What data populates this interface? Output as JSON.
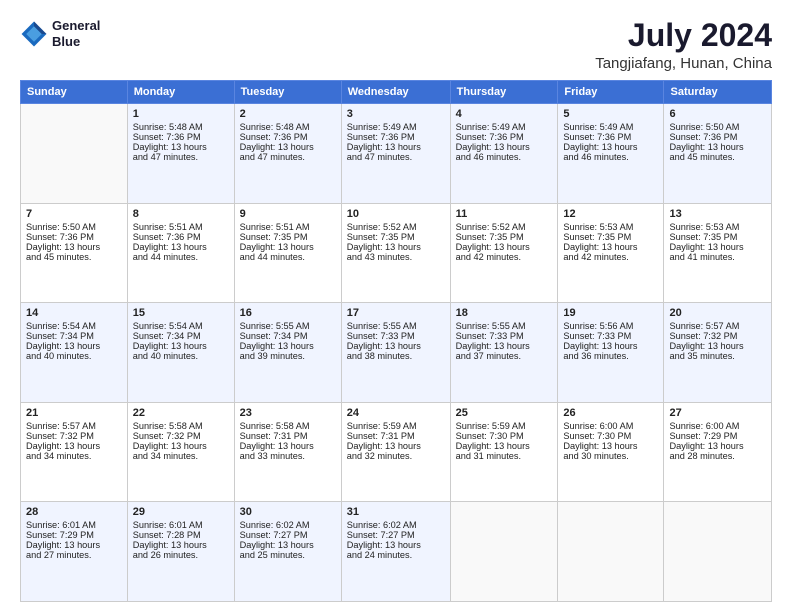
{
  "header": {
    "logo_line1": "General",
    "logo_line2": "Blue",
    "main_title": "July 2024",
    "subtitle": "Tangjiafang, Hunan, China"
  },
  "weekdays": [
    "Sunday",
    "Monday",
    "Tuesday",
    "Wednesday",
    "Thursday",
    "Friday",
    "Saturday"
  ],
  "weeks": [
    [
      {
        "day": "",
        "text": ""
      },
      {
        "day": "1",
        "text": "Sunrise: 5:48 AM\nSunset: 7:36 PM\nDaylight: 13 hours\nand 47 minutes."
      },
      {
        "day": "2",
        "text": "Sunrise: 5:48 AM\nSunset: 7:36 PM\nDaylight: 13 hours\nand 47 minutes."
      },
      {
        "day": "3",
        "text": "Sunrise: 5:49 AM\nSunset: 7:36 PM\nDaylight: 13 hours\nand 47 minutes."
      },
      {
        "day": "4",
        "text": "Sunrise: 5:49 AM\nSunset: 7:36 PM\nDaylight: 13 hours\nand 46 minutes."
      },
      {
        "day": "5",
        "text": "Sunrise: 5:49 AM\nSunset: 7:36 PM\nDaylight: 13 hours\nand 46 minutes."
      },
      {
        "day": "6",
        "text": "Sunrise: 5:50 AM\nSunset: 7:36 PM\nDaylight: 13 hours\nand 45 minutes."
      }
    ],
    [
      {
        "day": "7",
        "text": "Sunrise: 5:50 AM\nSunset: 7:36 PM\nDaylight: 13 hours\nand 45 minutes."
      },
      {
        "day": "8",
        "text": "Sunrise: 5:51 AM\nSunset: 7:36 PM\nDaylight: 13 hours\nand 44 minutes."
      },
      {
        "day": "9",
        "text": "Sunrise: 5:51 AM\nSunset: 7:35 PM\nDaylight: 13 hours\nand 44 minutes."
      },
      {
        "day": "10",
        "text": "Sunrise: 5:52 AM\nSunset: 7:35 PM\nDaylight: 13 hours\nand 43 minutes."
      },
      {
        "day": "11",
        "text": "Sunrise: 5:52 AM\nSunset: 7:35 PM\nDaylight: 13 hours\nand 42 minutes."
      },
      {
        "day": "12",
        "text": "Sunrise: 5:53 AM\nSunset: 7:35 PM\nDaylight: 13 hours\nand 42 minutes."
      },
      {
        "day": "13",
        "text": "Sunrise: 5:53 AM\nSunset: 7:35 PM\nDaylight: 13 hours\nand 41 minutes."
      }
    ],
    [
      {
        "day": "14",
        "text": "Sunrise: 5:54 AM\nSunset: 7:34 PM\nDaylight: 13 hours\nand 40 minutes."
      },
      {
        "day": "15",
        "text": "Sunrise: 5:54 AM\nSunset: 7:34 PM\nDaylight: 13 hours\nand 40 minutes."
      },
      {
        "day": "16",
        "text": "Sunrise: 5:55 AM\nSunset: 7:34 PM\nDaylight: 13 hours\nand 39 minutes."
      },
      {
        "day": "17",
        "text": "Sunrise: 5:55 AM\nSunset: 7:33 PM\nDaylight: 13 hours\nand 38 minutes."
      },
      {
        "day": "18",
        "text": "Sunrise: 5:55 AM\nSunset: 7:33 PM\nDaylight: 13 hours\nand 37 minutes."
      },
      {
        "day": "19",
        "text": "Sunrise: 5:56 AM\nSunset: 7:33 PM\nDaylight: 13 hours\nand 36 minutes."
      },
      {
        "day": "20",
        "text": "Sunrise: 5:57 AM\nSunset: 7:32 PM\nDaylight: 13 hours\nand 35 minutes."
      }
    ],
    [
      {
        "day": "21",
        "text": "Sunrise: 5:57 AM\nSunset: 7:32 PM\nDaylight: 13 hours\nand 34 minutes."
      },
      {
        "day": "22",
        "text": "Sunrise: 5:58 AM\nSunset: 7:32 PM\nDaylight: 13 hours\nand 34 minutes."
      },
      {
        "day": "23",
        "text": "Sunrise: 5:58 AM\nSunset: 7:31 PM\nDaylight: 13 hours\nand 33 minutes."
      },
      {
        "day": "24",
        "text": "Sunrise: 5:59 AM\nSunset: 7:31 PM\nDaylight: 13 hours\nand 32 minutes."
      },
      {
        "day": "25",
        "text": "Sunrise: 5:59 AM\nSunset: 7:30 PM\nDaylight: 13 hours\nand 31 minutes."
      },
      {
        "day": "26",
        "text": "Sunrise: 6:00 AM\nSunset: 7:30 PM\nDaylight: 13 hours\nand 30 minutes."
      },
      {
        "day": "27",
        "text": "Sunrise: 6:00 AM\nSunset: 7:29 PM\nDaylight: 13 hours\nand 28 minutes."
      }
    ],
    [
      {
        "day": "28",
        "text": "Sunrise: 6:01 AM\nSunset: 7:29 PM\nDaylight: 13 hours\nand 27 minutes."
      },
      {
        "day": "29",
        "text": "Sunrise: 6:01 AM\nSunset: 7:28 PM\nDaylight: 13 hours\nand 26 minutes."
      },
      {
        "day": "30",
        "text": "Sunrise: 6:02 AM\nSunset: 7:27 PM\nDaylight: 13 hours\nand 25 minutes."
      },
      {
        "day": "31",
        "text": "Sunrise: 6:02 AM\nSunset: 7:27 PM\nDaylight: 13 hours\nand 24 minutes."
      },
      {
        "day": "",
        "text": ""
      },
      {
        "day": "",
        "text": ""
      },
      {
        "day": "",
        "text": ""
      }
    ]
  ]
}
